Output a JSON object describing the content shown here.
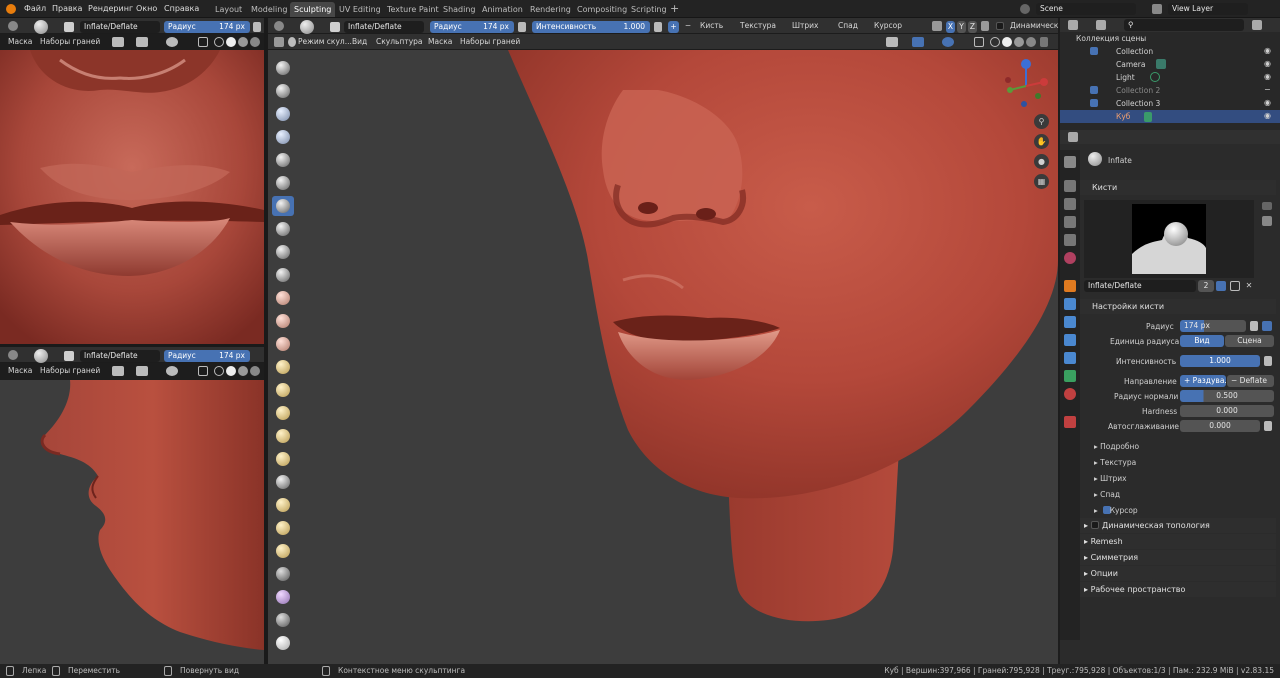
{
  "menu": [
    "Файл",
    "Правка",
    "Рендеринг",
    "Окно",
    "Справка"
  ],
  "workspaces": [
    "Layout",
    "Modeling",
    "Sculpting",
    "UV Editing",
    "Texture Paint",
    "Shading",
    "Animation",
    "Rendering",
    "Compositing",
    "Scripting"
  ],
  "active_workspace": "Sculpting",
  "add_tab": "+",
  "scene": "Scene",
  "view_layer": "View Layer",
  "topleft": {
    "brush": "Inflate/Deflate",
    "radius_label": "Радиус",
    "radius_value": "174 px",
    "mask": "Маска",
    "facesets": "Наборы граней"
  },
  "botleft": {
    "brush": "Inflate/Deflate",
    "radius_label": "Радиус",
    "radius_value": "174 px",
    "mask": "Маска",
    "facesets": "Наборы граней"
  },
  "main": {
    "mode": "Режим скул...",
    "brush": "Inflate/Deflate",
    "radius_label": "Радиус",
    "radius_value": "174 px",
    "strength_label": "Интенсивность",
    "strength_value": "1.000",
    "plus": "+",
    "minus": "−",
    "menus": [
      "Кисть",
      "Текстура",
      "Штрих",
      "Спад",
      "Курсор"
    ],
    "axes": [
      "X",
      "Y",
      "Z"
    ],
    "dyntopo": "Динамическ",
    "view": "Вид",
    "sculpt": "Скульптура",
    "mask": "Маска",
    "facesets": "Наборы граней"
  },
  "outliner": {
    "header": "Коллекция сцены",
    "rows": [
      "Collection",
      "Camera",
      "Light",
      "Collection 2",
      "Collection 3",
      "Куб"
    ]
  },
  "props": {
    "brush_name": "Inflate",
    "brushes_section": "Кисти",
    "brush_field": "Inflate/Deflate",
    "brush_users": "2",
    "settings_section": "Настройки кисти",
    "radius_label": "Радиус",
    "radius_value": "174 px",
    "radius_unit_label": "Единица радиуса",
    "unit_view": "Вид",
    "unit_scene": "Сцена",
    "strength_label": "Интенсивность",
    "strength_value": "1.000",
    "direction_label": "Направление",
    "dir_add": "+ Раздува...",
    "dir_sub": "−   Deflate",
    "normal_radius_label": "Радиус нормали",
    "normal_radius_value": "0.500",
    "hardness_label": "Hardness",
    "hardness_value": "0.000",
    "autosmooth_label": "Автосглаживание",
    "autosmooth_value": "0.000",
    "subsections": [
      "Подробно",
      "Текстура",
      "Штрих",
      "Спад",
      "Курсор"
    ],
    "sections": [
      "Динамическая топология",
      "Remesh",
      "Симметрия",
      "Опции",
      "Рабочее пространство"
    ]
  },
  "status": {
    "left1": "Лепка",
    "left2": "Переместить",
    "left3": "Повернуть вид",
    "left4": "Контекстное меню скульптинга",
    "right": "Куб | Вершин:397,966 | Граней:795,928 | Треуг.:795,928 | Объектов:1/3 | Пам.: 232.9 MiB | v2.83.15"
  },
  "colors": {
    "accent": "#4772b3",
    "skin": "#b5483a",
    "viewport_bg": "#3d3d3d"
  }
}
